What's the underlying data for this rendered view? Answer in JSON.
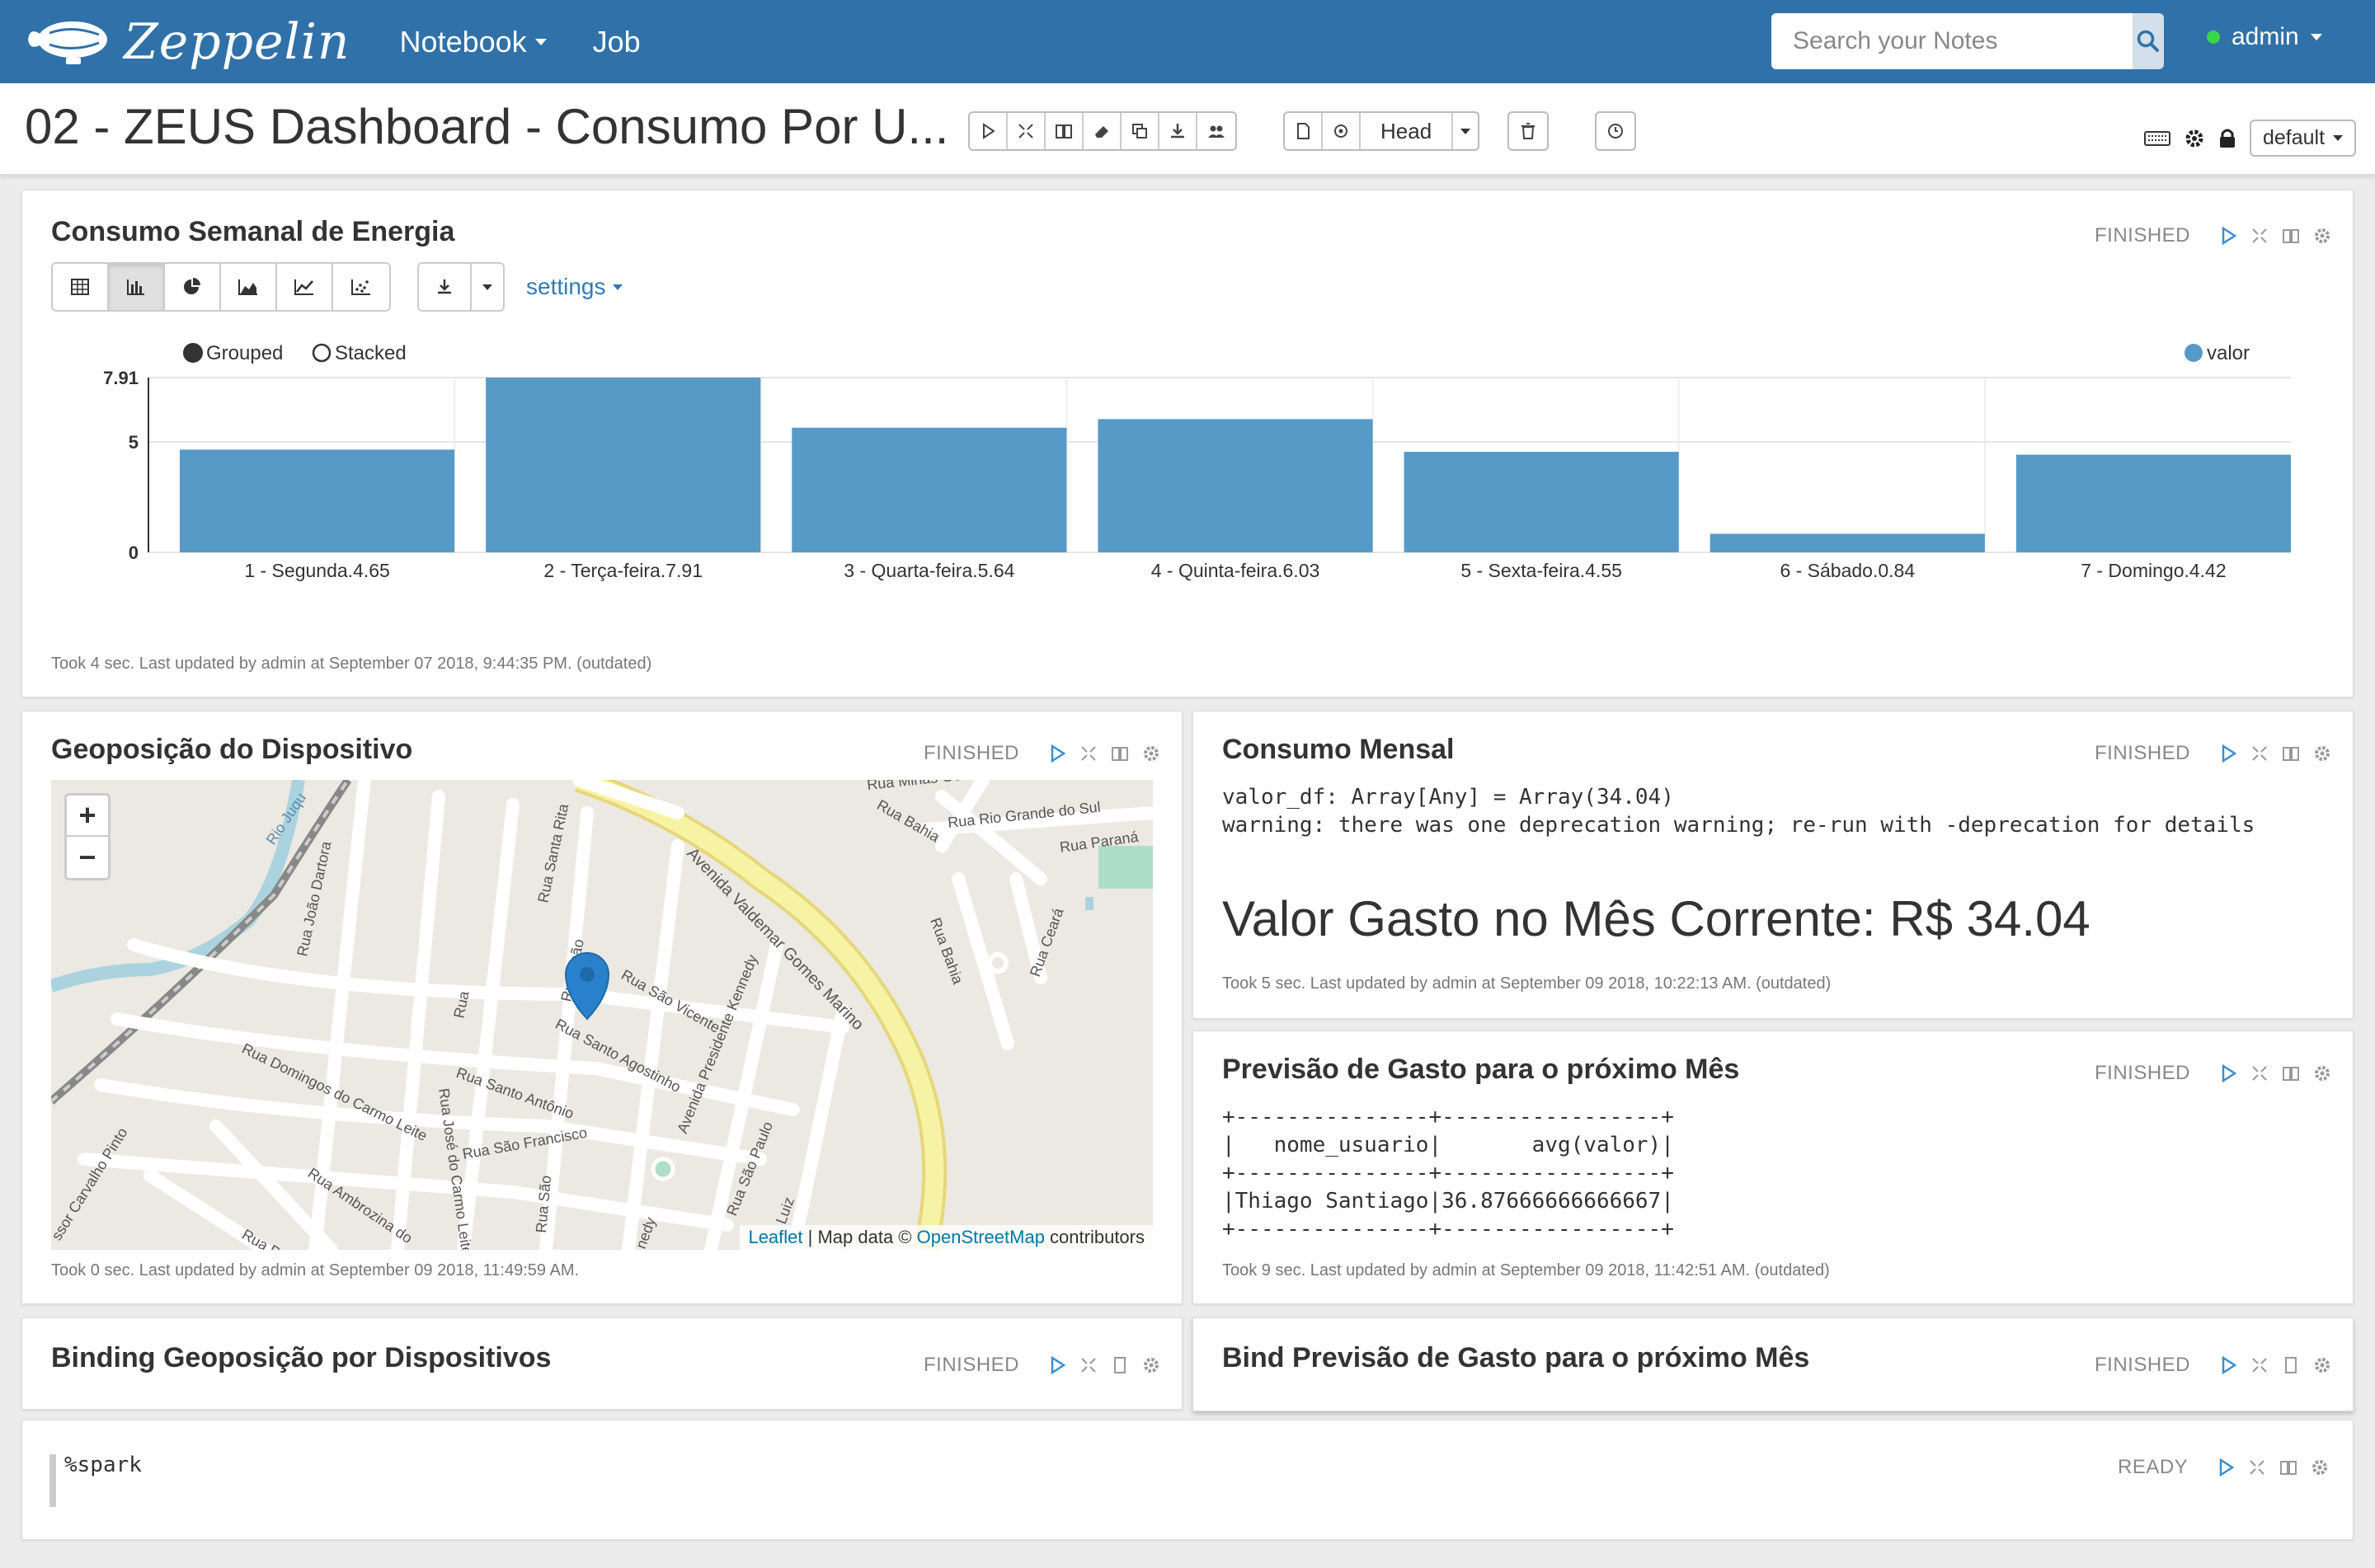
{
  "navbar": {
    "brand": "Zeppelin",
    "menu": [
      {
        "label": "Notebook",
        "has_caret": true
      },
      {
        "label": "Job",
        "has_caret": false
      }
    ],
    "search_placeholder": "Search your Notes",
    "user": "admin",
    "user_status_color": "#3bd54a"
  },
  "note": {
    "title": "02 - ZEUS Dashboard - Consumo Por U...",
    "head_label": "Head",
    "interpreter_label": "default"
  },
  "paragraphs": {
    "weekly": {
      "title": "Consumo Semanal de Energia",
      "status": "FINISHED",
      "settings_label": "settings",
      "footer": "Took 4 sec. Last updated by admin at September 07 2018, 9:44:35 PM. (outdated)",
      "grouped_label": "Grouped",
      "stacked_label": "Stacked"
    },
    "geo": {
      "title": "Geoposição do Dispositivo",
      "status": "FINISHED",
      "footer": "Took 0 sec. Last updated by admin at September 09 2018, 11:49:59 AM.",
      "zoom_in": "+",
      "zoom_out": "−",
      "attribution_leaflet": "Leaflet",
      "attribution_mid": " | Map data © ",
      "attribution_osm": "OpenStreetMap",
      "attribution_end": " contributors",
      "streets": [
        "Rua Minas Gerais",
        "Rua Bahia",
        "Rua Rio Grande do Sul",
        "Rua Paraná",
        "Avenida Valdemar Gomes Marino",
        "Rua João Dartora",
        "Rua Santa Rita",
        "Rua João",
        "Rua São Vicente",
        "Rua Santo Agostinho",
        "Rua Santo Antônio",
        "Rua Domingos do Carmo Leite",
        "Rua José do Carmo Leite",
        "Rua São Francisco",
        "Rua Ambrozina do",
        "Avenida Presidente Kennedy",
        "Rua São Paulo",
        "Rua Bahia",
        "Rua Ceará",
        "Rio Juqu",
        "ssor Carvalho Pinto",
        "Rua Do",
        "Rua São",
        "Luiz",
        "Rua",
        "nedy"
      ]
    },
    "monthly": {
      "title": "Consumo Mensal",
      "status": "FINISHED",
      "output_lines": [
        "valor_df: Array[Any] = Array(34.04)",
        "warning: there was one deprecation warning; re-run with -deprecation for details"
      ],
      "big_value": "Valor Gasto no Mês Corrente: R$ 34.04",
      "footer": "Took 5 sec. Last updated by admin at September 09 2018, 10:22:13 AM. (outdated)"
    },
    "forecast": {
      "title": "Previsão de Gasto para o próximo Mês",
      "status": "FINISHED",
      "output_lines": [
        "+---------------+-----------------+",
        "|   nome_usuario|       avg(valor)|",
        "+---------------+-----------------+",
        "|Thiago Santiago|36.87666666666667|",
        "+---------------+-----------------+"
      ],
      "footer": "Took 9 sec. Last updated by admin at September 09 2018, 11:42:51 AM. (outdated)"
    },
    "binding_geo": {
      "title": "Binding Geoposição por Dispositivos",
      "status": "FINISHED"
    },
    "bind_forecast": {
      "title": "Bind Previsão de Gasto para o próximo Mês",
      "status": "FINISHED"
    },
    "editor": {
      "code": "%spark",
      "status": "READY"
    }
  },
  "colors": {
    "navbar": "#3071a9",
    "bar": "#5799c7",
    "accent": "#337ab7"
  },
  "chart_data": {
    "type": "bar",
    "categories": [
      "1 - Segunda.4.65",
      "2 - Terça-feira.7.91",
      "3 - Quarta-feira.5.64",
      "4 - Quinta-feira.6.03",
      "5 - Sexta-feira.4.55",
      "6 - Sábado.0.84",
      "7 - Domingo.4.42"
    ],
    "series": [
      {
        "name": "valor",
        "values": [
          4.65,
          7.91,
          5.64,
          6.03,
          4.55,
          0.84,
          4.42
        ]
      }
    ],
    "y_ticks": [
      "0",
      "5",
      "7.91"
    ],
    "ylim": [
      0,
      7.91
    ],
    "grid": true,
    "legend_position": "top-right",
    "mode": "grouped"
  }
}
